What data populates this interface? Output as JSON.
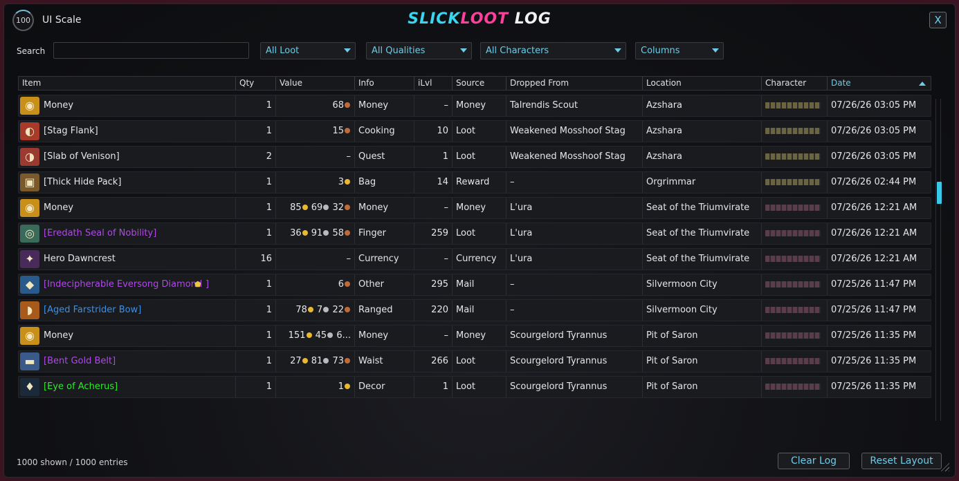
{
  "header": {
    "ui_scale_value": "100",
    "ui_scale_label": "UI Scale",
    "title_part1": "SLICK",
    "title_part2": "LOOT",
    "title_part3": " LOG",
    "close_label": "X"
  },
  "filters": {
    "search_label": "Search",
    "search_value": "",
    "loot_filter": "All Loot",
    "quality_filter": "All Qualities",
    "character_filter": "All Characters",
    "columns_label": "Columns"
  },
  "columns": [
    "Item",
    "Qty",
    "Value",
    "Info",
    "iLvl",
    "Source",
    "Dropped From",
    "Location",
    "Character",
    "Date"
  ],
  "sort_column": "Date",
  "rows": [
    {
      "item": "Money",
      "color": "#e6e6e6",
      "icon": "gold-coins-icon",
      "glyph": "◉",
      "iconbg": "#c8901a",
      "qty": "1",
      "value": "68",
      "coins": [
        "c"
      ],
      "info": "Money",
      "ilvl": "–",
      "source": "Money",
      "dropped": "Talrendis Scout",
      "location": "Azshara",
      "charcolor": "#6a6440",
      "date": "07/26/26 03:05 PM"
    },
    {
      "item": "[Stag Flank]",
      "color": "#e6e6e6",
      "icon": "meat-icon",
      "glyph": "◐",
      "iconbg": "#a83a2a",
      "qty": "1",
      "value": "15",
      "coins": [
        "c"
      ],
      "info": "Cooking",
      "ilvl": "10",
      "source": "Loot",
      "dropped": "Weakened Mosshoof Stag",
      "location": "Azshara",
      "charcolor": "#6a6440",
      "date": "07/26/26 03:05 PM"
    },
    {
      "item": "[Slab of Venison]",
      "color": "#e6e6e6",
      "icon": "venison-icon",
      "glyph": "◑",
      "iconbg": "#9a3a30",
      "qty": "2",
      "value": "–",
      "coins": [],
      "info": "Quest",
      "ilvl": "1",
      "source": "Loot",
      "dropped": "Weakened Mosshoof Stag",
      "location": "Azshara",
      "charcolor": "#6a6440",
      "date": "07/26/26 03:05 PM"
    },
    {
      "item": "[Thick Hide Pack]",
      "color": "#e6e6e6",
      "icon": "bag-icon",
      "glyph": "▣",
      "iconbg": "#7a5a2a",
      "qty": "1",
      "value": "3",
      "coins": [
        "g"
      ],
      "info": "Bag",
      "ilvl": "14",
      "source": "Reward",
      "dropped": "–",
      "location": "Orgrimmar",
      "charcolor": "#6a6440",
      "date": "07/26/26 02:44 PM"
    },
    {
      "item": "Money",
      "color": "#e6e6e6",
      "icon": "gold-coins-icon",
      "glyph": "◉",
      "iconbg": "#c8901a",
      "qty": "1",
      "value": "85 69 32",
      "coins": [
        "g",
        "s",
        "c"
      ],
      "vals": [
        "85",
        "69",
        "32"
      ],
      "info": "Money",
      "ilvl": "–",
      "source": "Money",
      "dropped": "L'ura",
      "location": "Seat of the Triumvirate",
      "charcolor": "#5a3c4a",
      "date": "07/26/26 12:21 AM"
    },
    {
      "item": "[Eredath Seal of Nobility]",
      "color": "#b048e8",
      "icon": "ring-icon",
      "glyph": "◎",
      "iconbg": "#3a6a5a",
      "qty": "1",
      "value": "36 91 58",
      "coins": [
        "g",
        "s",
        "c"
      ],
      "vals": [
        "36",
        "91",
        "58"
      ],
      "info": "Finger",
      "ilvl": "259",
      "source": "Loot",
      "dropped": "L'ura",
      "location": "Seat of the Triumvirate",
      "charcolor": "#5a3c4a",
      "date": "07/26/26 12:21 AM"
    },
    {
      "item": "Hero Dawncrest",
      "color": "#e6e6e6",
      "icon": "crest-icon",
      "glyph": "✦",
      "iconbg": "#4a2a5a",
      "qty": "16",
      "value": "–",
      "coins": [],
      "info": "Currency",
      "ilvl": "–",
      "source": "Currency",
      "dropped": "L'ura",
      "location": "Seat of the Triumvirate",
      "charcolor": "#5a3c4a",
      "date": "07/26/26 12:21 AM"
    },
    {
      "item": "[Indecipherable Eversong Diamond",
      "suffix": "]",
      "color": "#b048e8",
      "icon": "diamond-icon",
      "glyph": "◆",
      "iconbg": "#2a5a8a",
      "qty": "1",
      "value": "6",
      "coins": [
        "c"
      ],
      "info": "Other",
      "ilvl": "295",
      "source": "Mail",
      "dropped": "–",
      "location": "Silvermoon City",
      "charcolor": "#5a3c4a",
      "date": "07/25/26 11:47 PM"
    },
    {
      "item": "[Aged Farstrider Bow]",
      "color": "#3a90e8",
      "icon": "bow-icon",
      "glyph": "◗",
      "iconbg": "#a85a1a",
      "qty": "1",
      "value": "78 7 22",
      "coins": [
        "g",
        "s",
        "c"
      ],
      "vals": [
        "78",
        "7",
        "22"
      ],
      "info": "Ranged",
      "ilvl": "220",
      "source": "Mail",
      "dropped": "–",
      "location": "Silvermoon City",
      "charcolor": "#5a3c4a",
      "date": "07/25/26 11:47 PM"
    },
    {
      "item": "Money",
      "color": "#e6e6e6",
      "icon": "gold-coins-icon",
      "glyph": "◉",
      "iconbg": "#c8901a",
      "qty": "1",
      "value": "151 45 6...",
      "coins": [
        "g",
        "s",
        ""
      ],
      "vals": [
        "151",
        "45",
        "6..."
      ],
      "info": "Money",
      "ilvl": "–",
      "source": "Money",
      "dropped": "Scourgelord Tyrannus",
      "location": "Pit of Saron",
      "charcolor": "#5a3c4a",
      "date": "07/25/26 11:35 PM"
    },
    {
      "item": "[Bent Gold Belt]",
      "color": "#b048e8",
      "icon": "belt-icon",
      "glyph": "▬",
      "iconbg": "#3a5a8a",
      "qty": "1",
      "value": "27 81 73",
      "coins": [
        "g",
        "s",
        "c"
      ],
      "vals": [
        "27",
        "81",
        "73"
      ],
      "info": "Waist",
      "ilvl": "266",
      "source": "Loot",
      "dropped": "Scourgelord Tyrannus",
      "location": "Pit of Saron",
      "charcolor": "#5a3c4a",
      "date": "07/25/26 11:35 PM"
    },
    {
      "item": "[Eye of Acherus]",
      "color": "#30e830",
      "icon": "eye-icon",
      "glyph": "♦",
      "iconbg": "#1a2a3a",
      "qty": "1",
      "value": "1",
      "coins": [
        "g"
      ],
      "info": "Decor",
      "ilvl": "1",
      "source": "Loot",
      "dropped": "Scourgelord Tyrannus",
      "location": "Pit of Saron",
      "charcolor": "#5a3c4a",
      "date": "07/25/26 11:35 PM"
    }
  ],
  "footer": {
    "count_text": "1000 shown / 1000 entries",
    "clear_label": "Clear Log",
    "reset_label": "Reset Layout"
  },
  "colors": {
    "accent": "#6fcbe6",
    "title_cyan": "#3ad6f0",
    "title_pink": "#ff3f9c",
    "epic": "#b048e8",
    "rare": "#3a90e8",
    "uncommon": "#30e830"
  }
}
